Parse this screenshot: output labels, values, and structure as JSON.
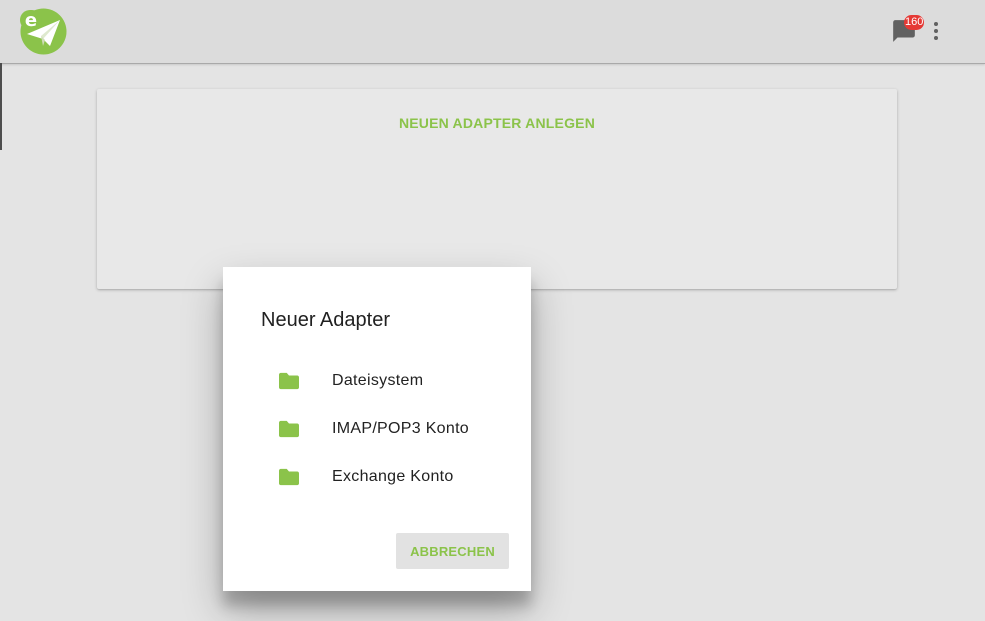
{
  "app": {
    "notification_count": "160",
    "colors": {
      "accent": "#8bc34a",
      "badge": "#e53935",
      "topbar": "#dcdcdc",
      "background": "#e4e4e4"
    },
    "icons": [
      "app-logo",
      "chat-icon",
      "more-vert-icon",
      "folder-icon"
    ]
  },
  "card": {
    "action_label": "NEUEN ADAPTER ANLEGEN"
  },
  "dialog": {
    "title": "Neuer Adapter",
    "options": [
      {
        "label": "Dateisystem",
        "icon": "folder-icon"
      },
      {
        "label": "IMAP/POP3 Konto",
        "icon": "folder-icon"
      },
      {
        "label": "Exchange Konto",
        "icon": "folder-icon"
      }
    ],
    "cancel_label": "ABBRECHEN"
  }
}
